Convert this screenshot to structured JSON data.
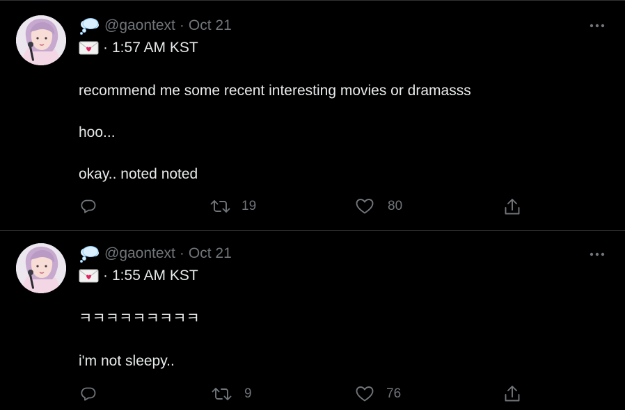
{
  "tweets": [
    {
      "handle": "@gaontext",
      "separator": "·",
      "date": "Oct 21",
      "time_separator": "·",
      "time": "1:57 AM KST",
      "lines": [
        "recommend me some recent interesting movies or dramasss",
        "hoo...",
        "okay.. noted noted"
      ],
      "retweets": "19",
      "likes": "80"
    },
    {
      "handle": "@gaontext",
      "separator": "·",
      "date": "Oct 21",
      "time_separator": "·",
      "time": "1:55 AM KST",
      "lines": [
        "ㅋㅋㅋㅋㅋㅋㅋㅋㅋ",
        "i'm not sleepy.."
      ],
      "retweets": "9",
      "likes": "76"
    }
  ],
  "icons": {
    "display_name_emoji": "thought-balloon-icon",
    "time_emoji": "love-letter-icon",
    "reply": "reply-icon",
    "retweet": "retweet-icon",
    "like": "heart-icon",
    "share": "share-icon",
    "more": "more-icon"
  },
  "colors": {
    "background": "#000000",
    "text": "#e7e9ea",
    "muted": "#71767b",
    "divider": "#2f3336"
  }
}
